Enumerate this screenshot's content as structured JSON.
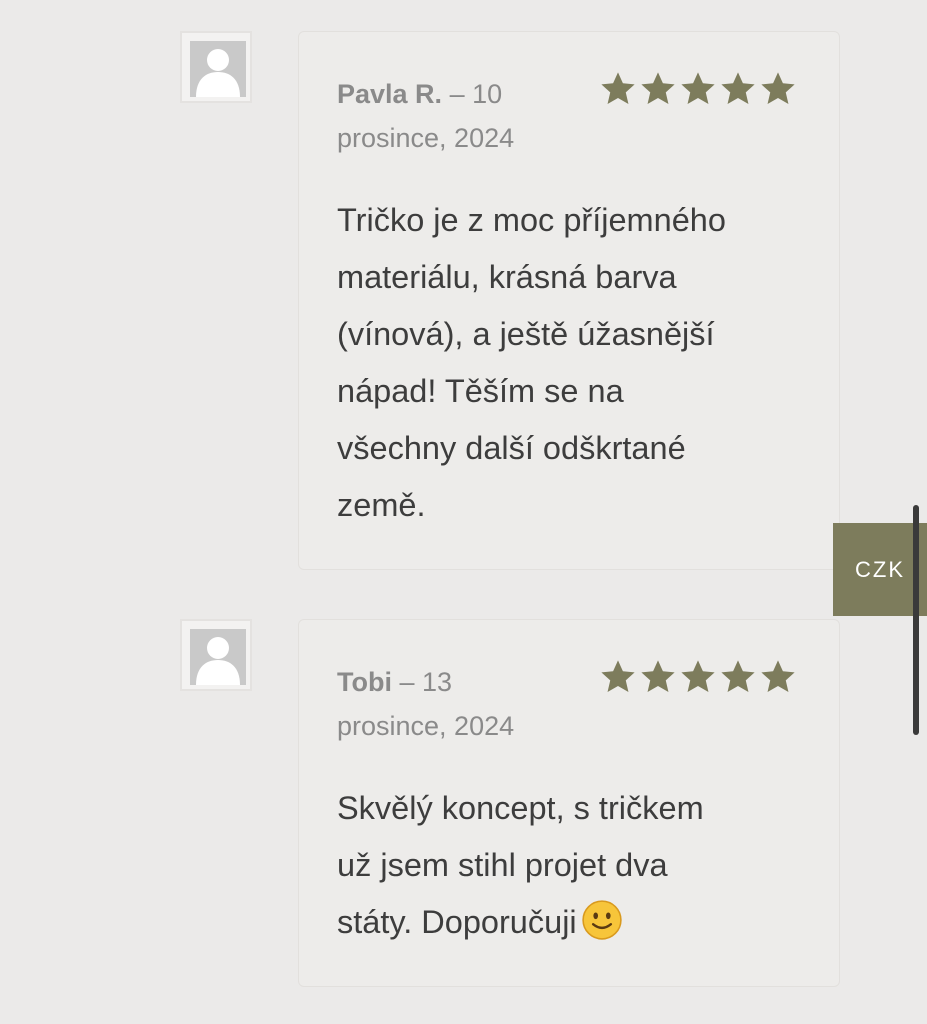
{
  "reviews": [
    {
      "author": "Pavla R.",
      "date_prefix": "– 10",
      "date_rest": "prosince, 2024",
      "rating": 5,
      "text_lines": [
        "Tričko je z moc příjemného",
        "materiálu, krásná barva",
        "(vínová), a ještě úžasnější",
        "nápad! Těším se na",
        "všechny další odškrtané",
        "země."
      ]
    },
    {
      "author": "Tobi",
      "date_prefix": "– 13",
      "date_rest": "prosince, 2024",
      "rating": 5,
      "text_lines": [
        "Skvělý koncept, s tričkem",
        "už jsem stihl projet dva",
        "státy. Doporučuji"
      ],
      "emoji": "🙂"
    }
  ],
  "currency_switcher": {
    "label": "CZK"
  },
  "colors": {
    "background": "#ebeae9",
    "star": "#7d7c5c",
    "accent": "#7d7c5c"
  },
  "icons": {
    "avatar": "user-placeholder-icon",
    "rating": "star-icon",
    "emoji": "slightly-smiling-face-icon"
  }
}
